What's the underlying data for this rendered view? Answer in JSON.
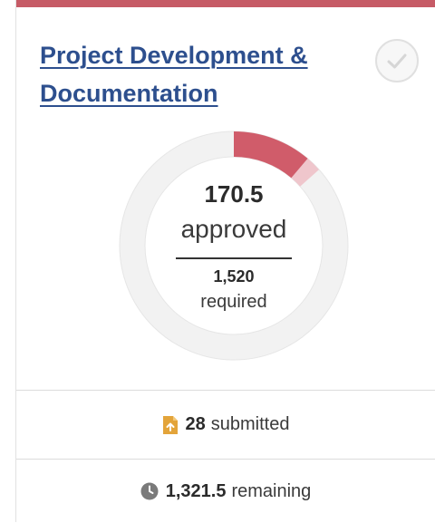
{
  "card": {
    "title": "Project Development & Documentation",
    "status_icon": "check-circle-icon",
    "accent_color": "#c65b66"
  },
  "progress": {
    "approved_value": "170.5",
    "approved_label": "approved",
    "required_value": "1,520",
    "required_label": "required",
    "approved_fraction": 0.112,
    "pending_fraction": 0.022
  },
  "stats": {
    "submitted_count": "28",
    "submitted_label": "submitted",
    "submitted_icon": "document-upload-icon",
    "remaining_count": "1,321.5",
    "remaining_label": "remaining",
    "remaining_icon": "clock-icon"
  },
  "colors": {
    "approved": "#d05c6a",
    "pending": "#efc6cc",
    "track": "#f2f2f2",
    "title_link": "#2d4f8e",
    "submitted_icon": "#e3a43a"
  }
}
